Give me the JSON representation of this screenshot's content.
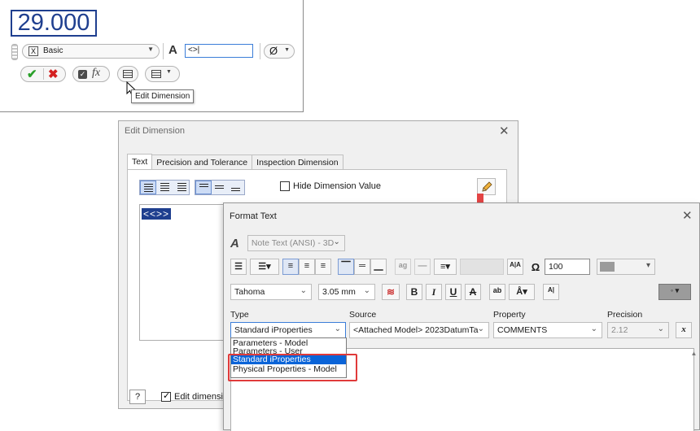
{
  "mini_toolbar": {
    "dimension_value": "29.000",
    "style_select": {
      "icon_text": "X",
      "value": "Basic"
    },
    "text_glyph": "A",
    "text_input_value": "<>|",
    "diameter_glyph": "Ø",
    "ok_glyph": "✔",
    "cancel_glyph": "✖",
    "fx_label": "fx",
    "tooltip": "Edit Dimension"
  },
  "edit_dimension_dialog": {
    "title": "Edit Dimension",
    "tabs": [
      {
        "label": "Text",
        "active": true
      },
      {
        "label": "Precision and Tolerance",
        "active": false
      },
      {
        "label": "Inspection Dimension",
        "active": false
      }
    ],
    "hide_dimension_value_label": "Hide Dimension Value",
    "hide_dimension_value_checked": false,
    "text_token": "<<>>",
    "help_glyph": "?",
    "edit_dimension_checkbox_label": "Edit dimension",
    "edit_dimension_checked": true
  },
  "format_text_dialog": {
    "title": "Format Text",
    "text_style_value": "Note Text (ANSI) - 3D",
    "width_value": "100",
    "font_value": "Tahoma",
    "size_value": "3.05 mm",
    "color_swatch": "#9b9b9b",
    "accent_color": "#0a64d8",
    "highlight_color": "#e03a3a",
    "labels": {
      "type": "Type",
      "source": "Source",
      "property": "Property",
      "precision": "Precision"
    },
    "type_value": "Standard iProperties",
    "source_value": "<Attached Model> 2023DatumTa",
    "property_value": "COMMENTS",
    "precision_value": "2.12",
    "type_options": [
      {
        "label": "Parameters - Model",
        "selected": false
      },
      {
        "label": "Parameters - User",
        "selected": false
      },
      {
        "label": "Standard iProperties",
        "selected": true
      },
      {
        "label": "Physical Properties - Model",
        "selected": false
      }
    ]
  }
}
